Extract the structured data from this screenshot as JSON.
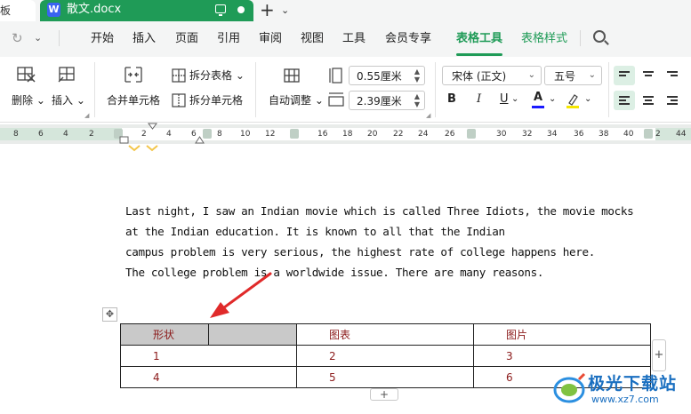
{
  "tabs": {
    "prev_tab_label": "板",
    "doc_icon_letter": "W",
    "doc_tab_label": "散文.docx",
    "new_tab": "+",
    "more_tabs": "⌄"
  },
  "menu": {
    "items": [
      "开始",
      "插入",
      "页面",
      "引用",
      "审阅",
      "视图",
      "工具",
      "会员专享",
      "表格工具",
      "表格样式"
    ],
    "active": "表格工具",
    "accent_color": "#1f9b57"
  },
  "ribbon": {
    "delete_label": "删除",
    "insert_label": "插入",
    "merge_cells_label": "合并单元格",
    "split_table_label": "拆分表格",
    "split_cells_label": "拆分单元格",
    "autofit_label": "自动调整",
    "row_height_value": "0.55厘米",
    "col_width_value": "2.39厘米",
    "font_name": "宋体 (正文)",
    "font_size": "五号",
    "bold_label": "B",
    "italic_label": "I",
    "underline_label": "U",
    "font_color_label": "A",
    "font_color": "#1a1aff",
    "highlight_color": "#f5e600"
  },
  "ruler": {
    "left_numbers": [
      "8",
      "6",
      "4",
      "4",
      "2",
      "2",
      "4",
      "6"
    ],
    "right_numbers": [
      "8",
      "10",
      "12",
      "16",
      "18",
      "20",
      "22",
      "24",
      "26",
      "30",
      "32",
      "34",
      "36",
      "38",
      "40",
      "2",
      "44"
    ]
  },
  "document": {
    "lines": [
      "Last night, I saw an Indian movie which is called Three Idiots, the movie mocks",
      "at the Indian education. It is known to all that the Indian",
      "campus problem is very serious, the highest rate of college happens here.",
      "The college problem is a worldwide issue. There are many reasons."
    ],
    "table": {
      "rows": [
        [
          "形状",
          "",
          "图表",
          "图片"
        ],
        [
          "1",
          "2",
          "3"
        ],
        [
          "4",
          "5",
          "6"
        ]
      ]
    },
    "add_col_label": "+",
    "add_row_label": "+",
    "move_handle_label": "✥"
  },
  "watermark": {
    "text": "极光下载站",
    "url": "www.xz7.com"
  }
}
